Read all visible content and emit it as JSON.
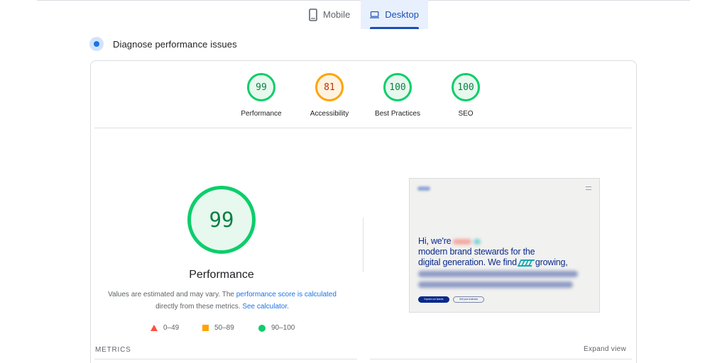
{
  "tabs": {
    "mobile_label": "Mobile",
    "desktop_label": "Desktop",
    "active": "Desktop"
  },
  "section": {
    "title": "Diagnose performance issues"
  },
  "scores": [
    {
      "label": "Performance",
      "value": "99",
      "status": "pass"
    },
    {
      "label": "Accessibility",
      "value": "81",
      "status": "average"
    },
    {
      "label": "Best Practices",
      "value": "100",
      "status": "pass"
    },
    {
      "label": "SEO",
      "value": "100",
      "status": "pass"
    }
  ],
  "main_gauge": {
    "value": "99",
    "label": "Performance",
    "desc_prefix": "Values are estimated and may vary. The ",
    "desc_link1": "performance score is calculated",
    "desc_middle": "directly from these metrics. ",
    "desc_link2": "See calculator."
  },
  "legend": {
    "fail": "0–49",
    "average": "50–89",
    "pass": "90–100"
  },
  "metrics": {
    "heading": "METRICS",
    "expand_label": "Expand view"
  },
  "preview": {
    "line1": "Hi, we're",
    "line2": "modern brand stewards for the",
    "line3_a": "digital generation. We find",
    "line3_b": "growing,",
    "button1": "Explore our brands",
    "button2": "Sell your business"
  },
  "colors": {
    "pass": "#0cce6b",
    "average": "#ffa400",
    "fail": "#ff4e42",
    "accent": "#1a73e8",
    "active_tab": "#1a4fb5"
  },
  "icons": {
    "mobile": "phone-icon",
    "desktop": "laptop-icon",
    "section": "diagnose-icon"
  }
}
